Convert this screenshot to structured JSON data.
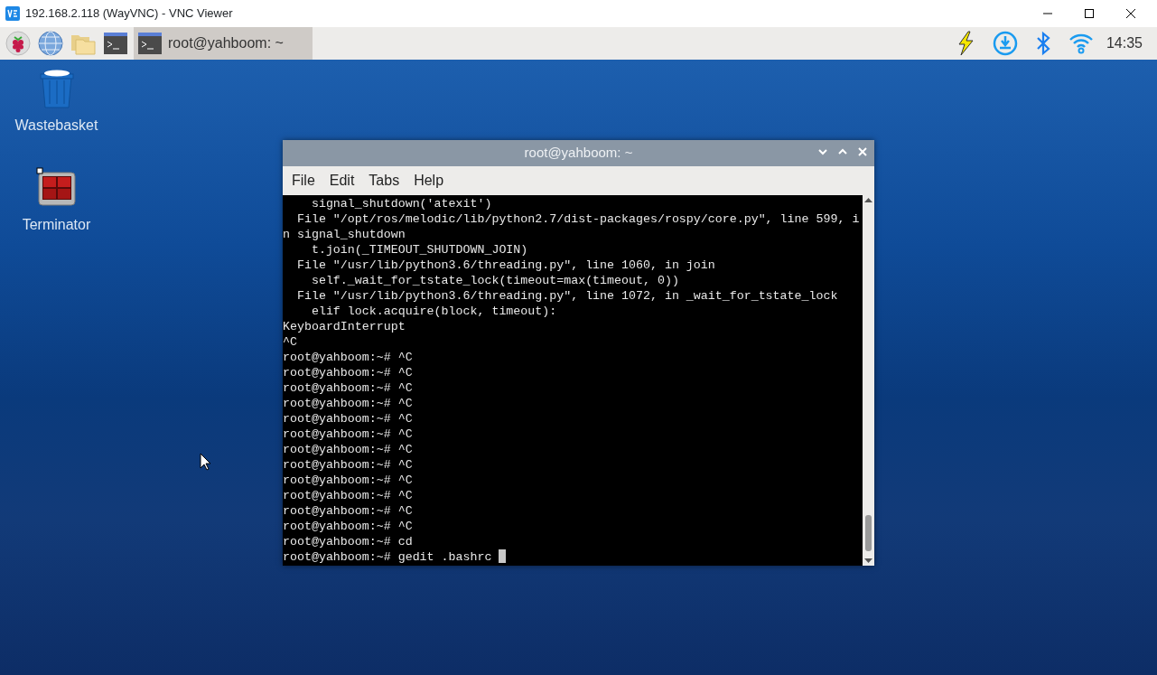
{
  "vnc_window": {
    "title": "192.168.2.118 (WayVNC) - VNC Viewer"
  },
  "taskbar": {
    "launchers": [
      {
        "kind": "raspberry"
      },
      {
        "kind": "globe"
      },
      {
        "kind": "folder"
      },
      {
        "kind": "terminal"
      }
    ],
    "tasks": [
      {
        "label": "root@yahboom: ~",
        "selected": true
      }
    ],
    "tray": [
      {
        "kind": "power"
      },
      {
        "kind": "download"
      },
      {
        "kind": "bluetooth"
      },
      {
        "kind": "wifi"
      }
    ],
    "clock": "14:35"
  },
  "desktop_icons": [
    {
      "label": "Wastebasket",
      "kind": "trash"
    },
    {
      "label": "Terminator",
      "kind": "terminator"
    }
  ],
  "terminal": {
    "title": "root@yahboom: ~",
    "menu": [
      "File",
      "Edit",
      "Tabs",
      "Help"
    ],
    "lines": [
      "    signal_shutdown('atexit')",
      "  File \"/opt/ros/melodic/lib/python2.7/dist-packages/rospy/core.py\", line 599, i",
      "n signal_shutdown",
      "    t.join(_TIMEOUT_SHUTDOWN_JOIN)",
      "  File \"/usr/lib/python3.6/threading.py\", line 1060, in join",
      "    self._wait_for_tstate_lock(timeout=max(timeout, 0))",
      "  File \"/usr/lib/python3.6/threading.py\", line 1072, in _wait_for_tstate_lock",
      "    elif lock.acquire(block, timeout):",
      "KeyboardInterrupt",
      "^C",
      "root@yahboom:~# ^C",
      "root@yahboom:~# ^C",
      "root@yahboom:~# ^C",
      "root@yahboom:~# ^C",
      "root@yahboom:~# ^C",
      "root@yahboom:~# ^C",
      "root@yahboom:~# ^C",
      "root@yahboom:~# ^C",
      "root@yahboom:~# ^C",
      "root@yahboom:~# ^C",
      "root@yahboom:~# ^C",
      "root@yahboom:~# ^C",
      "root@yahboom:~# cd",
      "root@yahboom:~# gedit .bashrc "
    ]
  }
}
